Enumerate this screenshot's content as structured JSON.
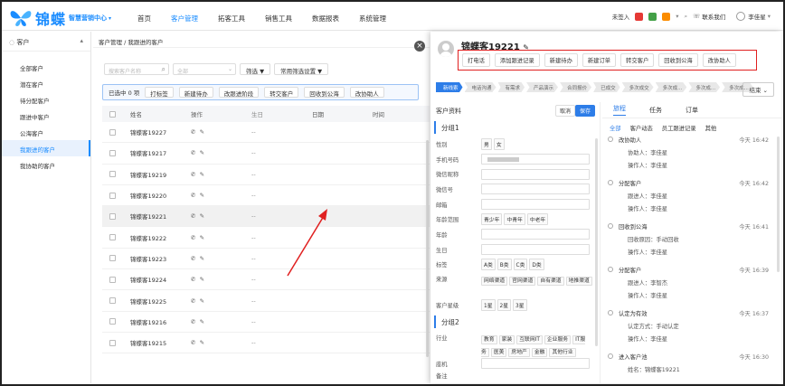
{
  "app": {
    "logo_main": "锦蝶",
    "logo_sub": "智慧营销中心",
    "logo_dropdown": "▾"
  },
  "nav": [
    "首页",
    "客户管理",
    "拓客工具",
    "销售工具",
    "数据报表",
    "系统管理"
  ],
  "topbar": {
    "checkin": "未签入",
    "contact": "联系我们",
    "user": "李佳星"
  },
  "sidebar": {
    "group": "客户",
    "items": [
      "全部客户",
      "潜在客户",
      "待分配客户",
      "跟进中客户",
      "公海客户",
      "我跟进的客户",
      "我协助的客户"
    ]
  },
  "main": {
    "breadcrumb": "客户管理 / 我跟进的客户",
    "search_placeholder": "搜索客户名称",
    "select_all": "全部",
    "filter_btn": "筛选",
    "saved_filter_btn": "常用筛选设置",
    "selected_text": "已选中 0 项",
    "bulk_actions": [
      "打标签",
      "新建待办",
      "改跟进阶段",
      "转交客户",
      "回收到公海",
      "改协助人"
    ],
    "columns": [
      "姓名",
      "操作",
      "生日",
      "日期",
      "时间"
    ],
    "rows": [
      {
        "name": "锦蝶客19227",
        "bd": "--"
      },
      {
        "name": "锦蝶客19217",
        "bd": "--"
      },
      {
        "name": "锦蝶客19219",
        "bd": "--"
      },
      {
        "name": "锦蝶客19220",
        "bd": "--"
      },
      {
        "name": "锦蝶客19221",
        "bd": "--"
      },
      {
        "name": "锦蝶客19222",
        "bd": "--"
      },
      {
        "name": "锦蝶客19223",
        "bd": "--"
      },
      {
        "name": "锦蝶客19224",
        "bd": "--"
      },
      {
        "name": "锦蝶客19225",
        "bd": "--"
      },
      {
        "name": "锦蝶客19216",
        "bd": "--"
      },
      {
        "name": "锦蝶客19215",
        "bd": "--"
      }
    ]
  },
  "panel": {
    "customer_name": "锦蝶客19221",
    "actions": [
      "打电话",
      "添加跟进记录",
      "新建待办",
      "新建订单",
      "转交客户",
      "回收到公海",
      "改协助人"
    ],
    "stages": [
      "新线索",
      "电话沟通",
      "有需求",
      "产品演示",
      "合同报价",
      "已成交",
      "多次成交",
      "多次成...",
      "多次成...",
      "多次成..."
    ],
    "result_btn": "结束",
    "profile_title": "客户资料",
    "cancel": "取消",
    "save": "保存",
    "group1": "分组1",
    "group2": "分组2",
    "fields": {
      "gender": "性别",
      "gender_opts": [
        "男",
        "女"
      ],
      "phone": "手机号码",
      "wechat_nick": "微信昵称",
      "wechat_id": "微信号",
      "email": "邮箱",
      "age_range": "年龄范围",
      "age_opts": [
        "青少年",
        "中青年",
        "中老年"
      ],
      "age": "年龄",
      "birthday": "生日",
      "tags": "标签",
      "tag_opts": [
        "A类",
        "B类",
        "C类",
        "D类"
      ],
      "source": "来源",
      "source_opts": [
        "网络渠道",
        "官网渠道",
        "自有渠道",
        "地推渠道"
      ],
      "stars": "客户星级",
      "star_opts": [
        "1星",
        "2星",
        "3星"
      ],
      "industry": "行业",
      "industry_opts": [
        "教育",
        "家装",
        "互联网IT",
        "企业服务",
        "IT服务",
        "医美",
        "房地产",
        "金融",
        "其他行业"
      ],
      "landline": "座机",
      "remark": "备注"
    },
    "right_tabs": [
      "旅程",
      "任务",
      "订单"
    ],
    "sub_tabs": [
      "全部",
      "客户动态",
      "员工跟进记录",
      "其他"
    ],
    "timeline": [
      {
        "title": "改协助人",
        "time": "今天 16:42",
        "lines": [
          "协助人：李佳星",
          "操作人：李佳星"
        ]
      },
      {
        "title": "分配客户",
        "time": "今天 16:42",
        "lines": [
          "跟进人：李佳星",
          "操作人：李佳星"
        ]
      },
      {
        "title": "回收到公海",
        "time": "今天 16:41",
        "lines": [
          "回收原因：手动回收",
          "操作人：李佳星"
        ]
      },
      {
        "title": "分配客户",
        "time": "今天 16:39",
        "lines": [
          "跟进人：李智杰",
          "操作人：李佳星"
        ]
      },
      {
        "title": "认定为有效",
        "time": "今天 16:37",
        "lines": [
          "认定方式：手动认定",
          "操作人：李佳星"
        ]
      },
      {
        "title": "进入客户池",
        "time": "今天 16:30",
        "lines": [
          "姓名：锦蝶客19221"
        ]
      }
    ]
  },
  "colors": {
    "brand": "#1a8cff",
    "accent": "#2d7de8",
    "highlight_box": "#e02020",
    "arrow": "#e02020"
  }
}
